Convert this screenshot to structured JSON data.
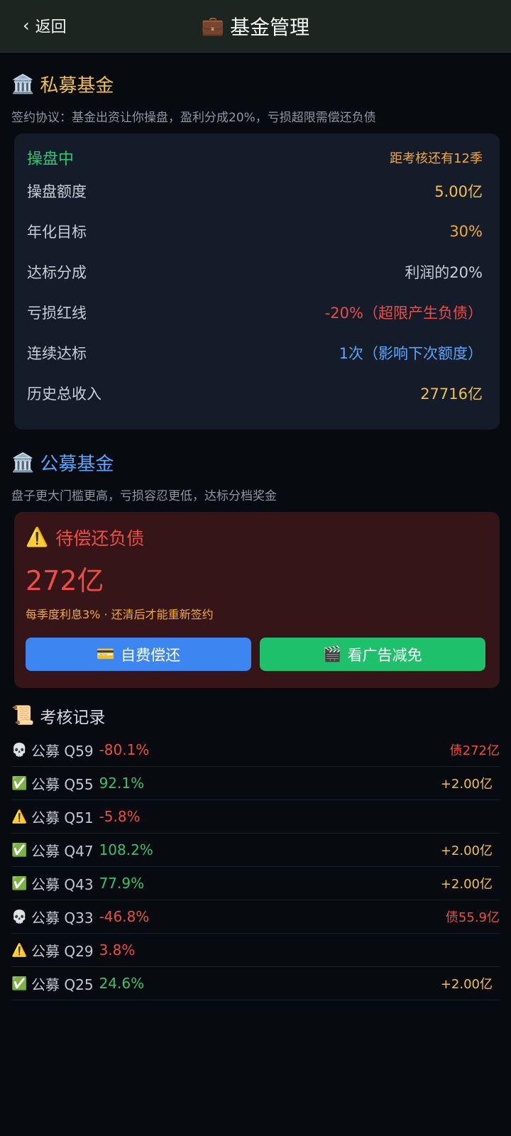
{
  "header": {
    "back_chevron": "‹",
    "back_label": "返回",
    "title_icon": "💼",
    "title": "基金管理"
  },
  "private_fund": {
    "icon": "🏛️",
    "title": "私募基金",
    "subtitle": "签约协议：基金出资让你操盘，盈利分成20%，亏损超限需偿还负债",
    "status": "操盘中",
    "countdown": "距考核还有12季",
    "rows": [
      {
        "label": "操盘额度",
        "value": "5.00亿",
        "color": "#f3c047"
      },
      {
        "label": "年化目标",
        "value": "30%",
        "color": "#f3a93a"
      },
      {
        "label": "达标分成",
        "value": "利润的20%",
        "color": "#c9ced6"
      },
      {
        "label": "亏损红线",
        "value": "-20%（超限产生负债）",
        "color": "#ef4c44"
      },
      {
        "label": "连续达标",
        "value": "1次（影响下次额度）",
        "color": "#5aa6ff"
      },
      {
        "label": "历史总收入",
        "value": "27716亿",
        "color": "#f3c047"
      }
    ]
  },
  "public_fund": {
    "icon": "🏛️",
    "title": "公募基金",
    "subtitle": "盘子更大门槛更高，亏损容忍更低，达标分档奖金"
  },
  "debt": {
    "icon": "⚠️",
    "title": "待偿还负债",
    "amount": "272亿",
    "note": "每季度利息3% · 还清后才能重新签约",
    "pay_icon": "💳",
    "pay_label": "自费偿还",
    "ad_icon": "🎬",
    "ad_label": "看广告减免"
  },
  "records": {
    "icon": "📜",
    "title": "考核记录",
    "items": [
      {
        "icon": "💀",
        "icon_name": "skull-icon",
        "label": "公募 Q59",
        "value": "-80.1%",
        "value_color": "#ef4c44",
        "right": "债272亿",
        "right_color": "#ef4c44",
        "right_is_debt": true
      },
      {
        "icon": "✅",
        "icon_name": "check-icon",
        "label": "公募 Q55",
        "value": "92.1%",
        "value_color": "#2fc671",
        "right": "+2.00亿",
        "right_color": "#f3c047",
        "right_is_debt": false
      },
      {
        "icon": "⚠️",
        "icon_name": "warning-icon",
        "label": "公募 Q51",
        "value": "-5.8%",
        "value_color": "#ef4c44",
        "right": "",
        "right_color": "#f3c047",
        "right_is_debt": false
      },
      {
        "icon": "✅",
        "icon_name": "check-icon",
        "label": "公募 Q47",
        "value": "108.2%",
        "value_color": "#2fc671",
        "right": "+2.00亿",
        "right_color": "#f3c047",
        "right_is_debt": false
      },
      {
        "icon": "✅",
        "icon_name": "check-icon",
        "label": "公募 Q43",
        "value": "77.9%",
        "value_color": "#2fc671",
        "right": "+2.00亿",
        "right_color": "#f3c047",
        "right_is_debt": false
      },
      {
        "icon": "💀",
        "icon_name": "skull-icon",
        "label": "公募 Q33",
        "value": "-46.8%",
        "value_color": "#ef4c44",
        "right": "债55.9亿",
        "right_color": "#ef4c44",
        "right_is_debt": true
      },
      {
        "icon": "⚠️",
        "icon_name": "warning-icon",
        "label": "公募 Q29",
        "value": "3.8%",
        "value_color": "#ef4c44",
        "right": "",
        "right_color": "#f3c047",
        "right_is_debt": false
      },
      {
        "icon": "✅",
        "icon_name": "check-icon",
        "label": "公募 Q25",
        "value": "24.6%",
        "value_color": "#2fc671",
        "right": "+2.00亿",
        "right_color": "#f3c047",
        "right_is_debt": false
      }
    ]
  }
}
